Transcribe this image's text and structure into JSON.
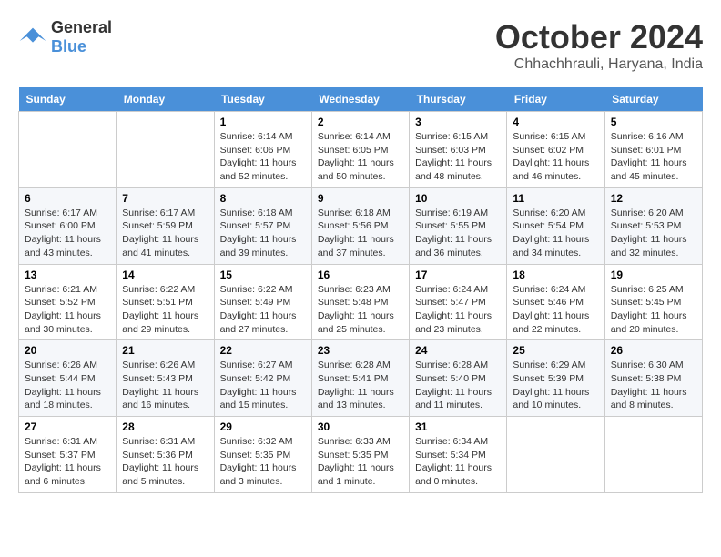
{
  "logo": {
    "general": "General",
    "blue": "Blue"
  },
  "title": "October 2024",
  "location": "Chhachhrauli, Haryana, India",
  "days_of_week": [
    "Sunday",
    "Monday",
    "Tuesday",
    "Wednesday",
    "Thursday",
    "Friday",
    "Saturday"
  ],
  "weeks": [
    [
      {
        "day": "",
        "sunrise": "",
        "sunset": "",
        "daylight": ""
      },
      {
        "day": "",
        "sunrise": "",
        "sunset": "",
        "daylight": ""
      },
      {
        "day": "1",
        "sunrise": "Sunrise: 6:14 AM",
        "sunset": "Sunset: 6:06 PM",
        "daylight": "Daylight: 11 hours and 52 minutes."
      },
      {
        "day": "2",
        "sunrise": "Sunrise: 6:14 AM",
        "sunset": "Sunset: 6:05 PM",
        "daylight": "Daylight: 11 hours and 50 minutes."
      },
      {
        "day": "3",
        "sunrise": "Sunrise: 6:15 AM",
        "sunset": "Sunset: 6:03 PM",
        "daylight": "Daylight: 11 hours and 48 minutes."
      },
      {
        "day": "4",
        "sunrise": "Sunrise: 6:15 AM",
        "sunset": "Sunset: 6:02 PM",
        "daylight": "Daylight: 11 hours and 46 minutes."
      },
      {
        "day": "5",
        "sunrise": "Sunrise: 6:16 AM",
        "sunset": "Sunset: 6:01 PM",
        "daylight": "Daylight: 11 hours and 45 minutes."
      }
    ],
    [
      {
        "day": "6",
        "sunrise": "Sunrise: 6:17 AM",
        "sunset": "Sunset: 6:00 PM",
        "daylight": "Daylight: 11 hours and 43 minutes."
      },
      {
        "day": "7",
        "sunrise": "Sunrise: 6:17 AM",
        "sunset": "Sunset: 5:59 PM",
        "daylight": "Daylight: 11 hours and 41 minutes."
      },
      {
        "day": "8",
        "sunrise": "Sunrise: 6:18 AM",
        "sunset": "Sunset: 5:57 PM",
        "daylight": "Daylight: 11 hours and 39 minutes."
      },
      {
        "day": "9",
        "sunrise": "Sunrise: 6:18 AM",
        "sunset": "Sunset: 5:56 PM",
        "daylight": "Daylight: 11 hours and 37 minutes."
      },
      {
        "day": "10",
        "sunrise": "Sunrise: 6:19 AM",
        "sunset": "Sunset: 5:55 PM",
        "daylight": "Daylight: 11 hours and 36 minutes."
      },
      {
        "day": "11",
        "sunrise": "Sunrise: 6:20 AM",
        "sunset": "Sunset: 5:54 PM",
        "daylight": "Daylight: 11 hours and 34 minutes."
      },
      {
        "day": "12",
        "sunrise": "Sunrise: 6:20 AM",
        "sunset": "Sunset: 5:53 PM",
        "daylight": "Daylight: 11 hours and 32 minutes."
      }
    ],
    [
      {
        "day": "13",
        "sunrise": "Sunrise: 6:21 AM",
        "sunset": "Sunset: 5:52 PM",
        "daylight": "Daylight: 11 hours and 30 minutes."
      },
      {
        "day": "14",
        "sunrise": "Sunrise: 6:22 AM",
        "sunset": "Sunset: 5:51 PM",
        "daylight": "Daylight: 11 hours and 29 minutes."
      },
      {
        "day": "15",
        "sunrise": "Sunrise: 6:22 AM",
        "sunset": "Sunset: 5:49 PM",
        "daylight": "Daylight: 11 hours and 27 minutes."
      },
      {
        "day": "16",
        "sunrise": "Sunrise: 6:23 AM",
        "sunset": "Sunset: 5:48 PM",
        "daylight": "Daylight: 11 hours and 25 minutes."
      },
      {
        "day": "17",
        "sunrise": "Sunrise: 6:24 AM",
        "sunset": "Sunset: 5:47 PM",
        "daylight": "Daylight: 11 hours and 23 minutes."
      },
      {
        "day": "18",
        "sunrise": "Sunrise: 6:24 AM",
        "sunset": "Sunset: 5:46 PM",
        "daylight": "Daylight: 11 hours and 22 minutes."
      },
      {
        "day": "19",
        "sunrise": "Sunrise: 6:25 AM",
        "sunset": "Sunset: 5:45 PM",
        "daylight": "Daylight: 11 hours and 20 minutes."
      }
    ],
    [
      {
        "day": "20",
        "sunrise": "Sunrise: 6:26 AM",
        "sunset": "Sunset: 5:44 PM",
        "daylight": "Daylight: 11 hours and 18 minutes."
      },
      {
        "day": "21",
        "sunrise": "Sunrise: 6:26 AM",
        "sunset": "Sunset: 5:43 PM",
        "daylight": "Daylight: 11 hours and 16 minutes."
      },
      {
        "day": "22",
        "sunrise": "Sunrise: 6:27 AM",
        "sunset": "Sunset: 5:42 PM",
        "daylight": "Daylight: 11 hours and 15 minutes."
      },
      {
        "day": "23",
        "sunrise": "Sunrise: 6:28 AM",
        "sunset": "Sunset: 5:41 PM",
        "daylight": "Daylight: 11 hours and 13 minutes."
      },
      {
        "day": "24",
        "sunrise": "Sunrise: 6:28 AM",
        "sunset": "Sunset: 5:40 PM",
        "daylight": "Daylight: 11 hours and 11 minutes."
      },
      {
        "day": "25",
        "sunrise": "Sunrise: 6:29 AM",
        "sunset": "Sunset: 5:39 PM",
        "daylight": "Daylight: 11 hours and 10 minutes."
      },
      {
        "day": "26",
        "sunrise": "Sunrise: 6:30 AM",
        "sunset": "Sunset: 5:38 PM",
        "daylight": "Daylight: 11 hours and 8 minutes."
      }
    ],
    [
      {
        "day": "27",
        "sunrise": "Sunrise: 6:31 AM",
        "sunset": "Sunset: 5:37 PM",
        "daylight": "Daylight: 11 hours and 6 minutes."
      },
      {
        "day": "28",
        "sunrise": "Sunrise: 6:31 AM",
        "sunset": "Sunset: 5:36 PM",
        "daylight": "Daylight: 11 hours and 5 minutes."
      },
      {
        "day": "29",
        "sunrise": "Sunrise: 6:32 AM",
        "sunset": "Sunset: 5:35 PM",
        "daylight": "Daylight: 11 hours and 3 minutes."
      },
      {
        "day": "30",
        "sunrise": "Sunrise: 6:33 AM",
        "sunset": "Sunset: 5:35 PM",
        "daylight": "Daylight: 11 hours and 1 minute."
      },
      {
        "day": "31",
        "sunrise": "Sunrise: 6:34 AM",
        "sunset": "Sunset: 5:34 PM",
        "daylight": "Daylight: 11 hours and 0 minutes."
      },
      {
        "day": "",
        "sunrise": "",
        "sunset": "",
        "daylight": ""
      },
      {
        "day": "",
        "sunrise": "",
        "sunset": "",
        "daylight": ""
      }
    ]
  ]
}
